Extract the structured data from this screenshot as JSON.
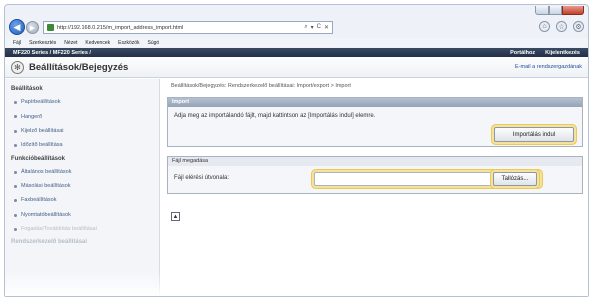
{
  "browser": {
    "url": "http://192.168.0.215/m_import_address_import.html",
    "address_tools": [
      "⌕",
      "▾",
      "C",
      "✕"
    ],
    "back_arrow": "◀",
    "forward_arrow": "▶",
    "toolbar_icons": [
      "⌂",
      "☆",
      "⚙"
    ],
    "window_controls": [
      "min",
      "max",
      "close"
    ]
  },
  "menu": [
    "Fájl",
    "Szerkesztés",
    "Nézet",
    "Kedvencek",
    "Eszközök",
    "Súgó"
  ],
  "device_bar": {
    "model": "MF220 Series / MF220 Series /",
    "links": [
      "Portálhoz",
      "Kijelentkezés"
    ]
  },
  "page": {
    "title_icon": "✻",
    "title": "Beállítások/Bejegyzés",
    "email_link": "E-mail a rendszergazdának"
  },
  "sidebar": {
    "sections": [
      {
        "heading": "Beállítások",
        "items": [
          "Papírbeállítások",
          "Hangerő",
          "Kijelző beállításai",
          "Időzítő beállítása"
        ]
      },
      {
        "heading": "Funkcióbeállítások",
        "items": [
          "Általános beállítások",
          "Másolási beállítások",
          "Faxbeállítások",
          "Nyomtatóbeállítások",
          "Fogadás/Továbbítás beállításai"
        ]
      }
    ],
    "faded_heading": "Rendszerkezelő beállításai"
  },
  "main": {
    "breadcrumb": "Beállítások/Bejegyzés: Rendszerkezelő beállításai: Import/export > Import",
    "import_panel": {
      "header": "Import",
      "instruction": "Adja meg az importálandó fájlt, majd kattintson az [Importálás indul] elemre.",
      "start_button": "Importálás indul"
    },
    "file_panel": {
      "header": "Fájl megadása",
      "label": "Fájl elérési útvonala:",
      "input_value": "",
      "browse_button": "Tallózás..."
    },
    "to_top_icon": "▲"
  },
  "colors": {
    "dark_header": "#22304a",
    "panel_header": "#95a3b7",
    "highlight": "#e9c95b",
    "link": "#1f4d9c"
  }
}
